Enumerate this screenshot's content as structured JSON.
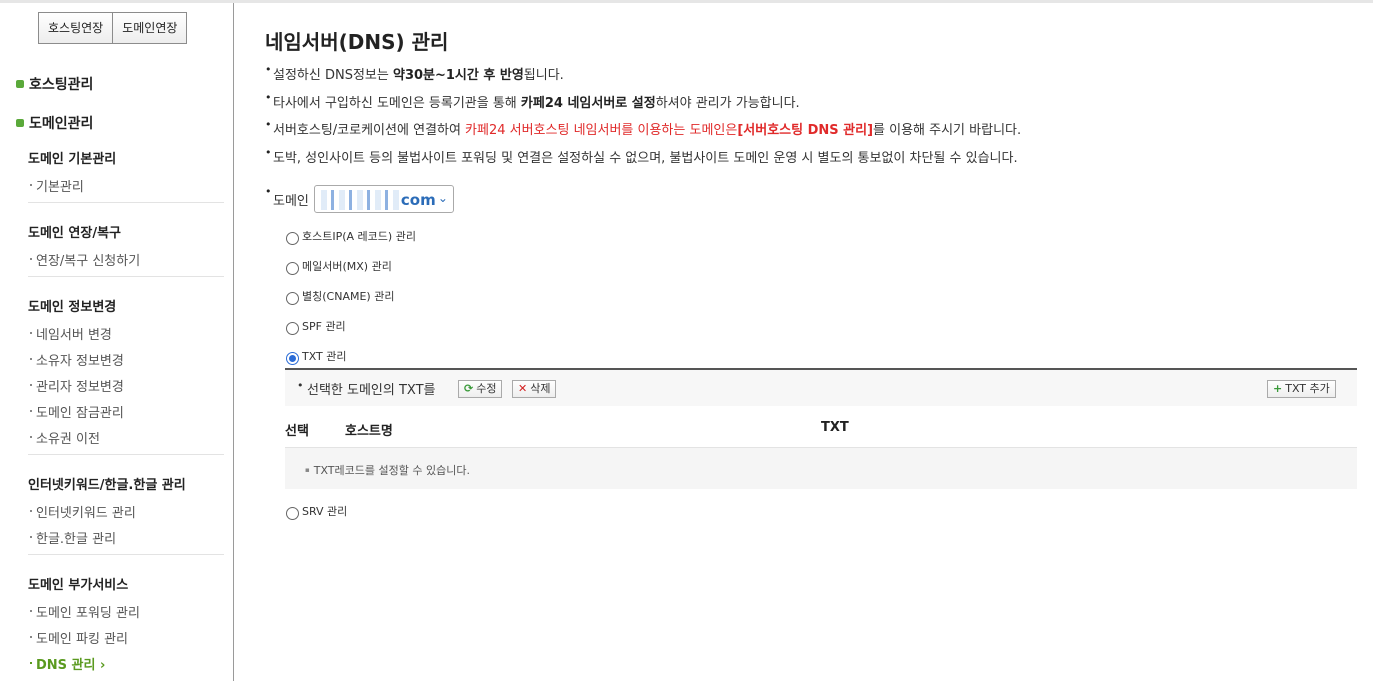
{
  "top_buttons": [
    "호스팅연장",
    "도메인연장"
  ],
  "sidebar": {
    "hosting_mgmt": "호스팅관리",
    "domain_mgmt": "도메인관리",
    "cat_basic": "도메인 기본관리",
    "basic_item": "기본관리",
    "cat_extend": "도메인 연장/복구",
    "extend_item": "연장/복구 신청하기",
    "cat_info": "도메인 정보변경",
    "info_items": [
      "네임서버 변경",
      "소유자 정보변경",
      "관리자 정보변경",
      "도메인 잠금관리",
      "소유권 이전"
    ],
    "cat_keyword": "인터넷키워드/한글.한글 관리",
    "keyword_items": [
      "인터넷키워드 관리",
      "한글.한글 관리"
    ],
    "cat_extra": "도메인 부가서비스",
    "extra_items": [
      "도메인 포워딩 관리",
      "도메인 파킹 관리",
      "DNS 관리 ›"
    ]
  },
  "main": {
    "title": "네임서버(DNS) 관리",
    "n1_a": "설정하신 DNS정보는 ",
    "n1_b": "약30분~1시간 후 반영",
    "n1_c": "됩니다.",
    "n2_a": "타사에서 구입하신 도메인은 등록기관을 통해 ",
    "n2_b": "카페24 네임서버로 설정",
    "n2_c": "하셔야 관리가 가능합니다.",
    "n3_a": "서버호스팅/코로케이션에 연결하여 ",
    "n3_b": "카페24 서버호스팅 네임서버를 이용하는 도메인은",
    "n3_c": "[서버호스팅 DNS 관리]",
    "n3_d": "를 이용해 주시기 바랍니다.",
    "n4": "도박, 성인사이트 등의 불법사이트 포워딩 및 연결은 설정하실 수 없으며, 불법사이트 도메인 운영 시 별도의 통보없이 차단될 수 있습니다.",
    "domain_label": "도메인",
    "domain_value": "com",
    "records": [
      "호스트IP(A 레코드) 관리",
      "메일서버(MX) 관리",
      "별칭(CNAME) 관리",
      "SPF 관리",
      "TXT 관리",
      "SRV 관리"
    ],
    "selected_record": "TXT 관리"
  },
  "txt_panel": {
    "heading": "선택한 도메인의 TXT를",
    "edit": "수정",
    "delete": "삭제",
    "add": "TXT 추가",
    "col_select": "선택",
    "col_host": "호스트명",
    "col_txt": "TXT",
    "empty": "TXT레코드를 설정할 수 있습니다."
  },
  "colors": {
    "accent_green": "#5a9a1f",
    "notice_red": "#e02a2a",
    "radio_blue": "#2b6cd6"
  }
}
